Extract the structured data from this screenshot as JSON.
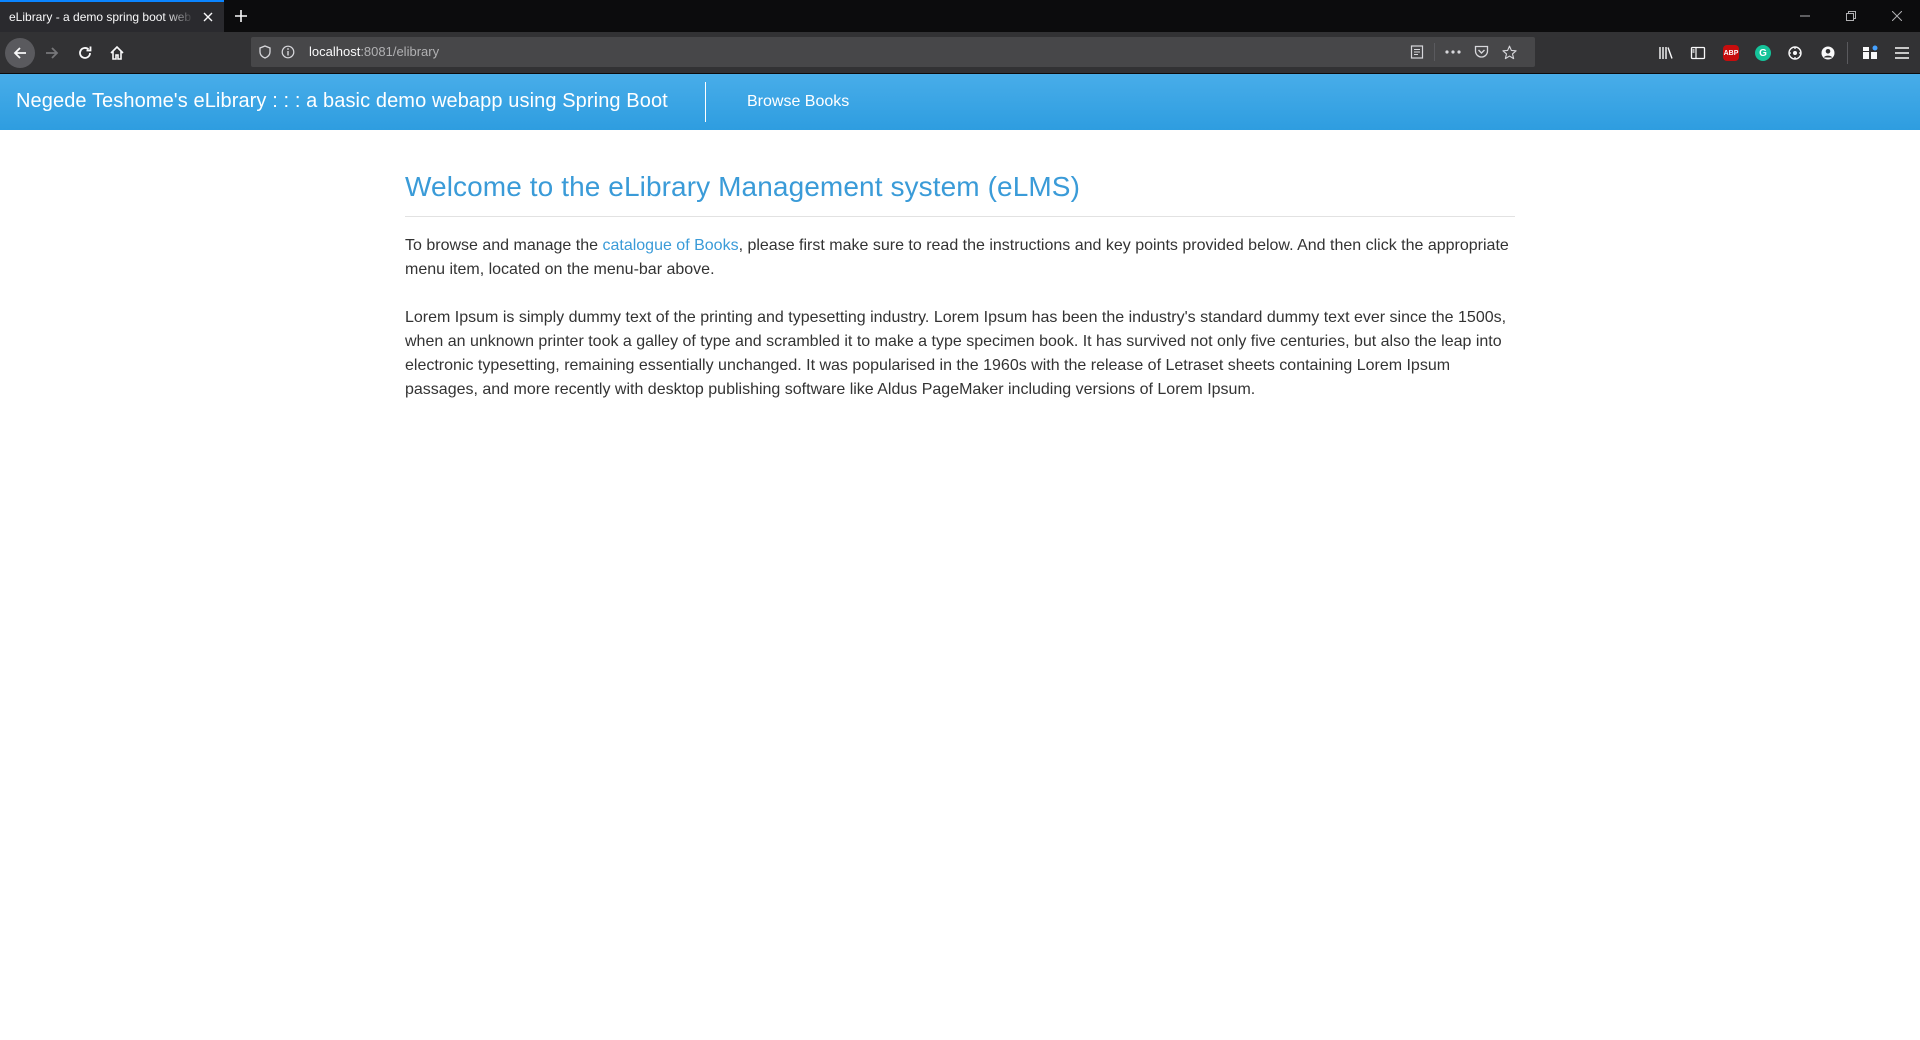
{
  "browser": {
    "tab_title": "eLibrary - a demo spring boot web",
    "url_host": "localhost",
    "url_path": ":8081/elibrary",
    "icons": {
      "tab_close": "close-icon",
      "new_tab": "plus-icon",
      "minimize": "minimize-icon",
      "restore": "restore-icon",
      "close_window": "close-window-icon",
      "back": "arrow-left-icon",
      "forward": "arrow-right-icon",
      "reload": "reload-icon",
      "home": "home-icon",
      "shield": "shield-icon",
      "info": "info-icon",
      "reader": "reader-view-icon",
      "more": "ellipsis-icon",
      "pocket": "pocket-icon",
      "bookmark": "star-icon",
      "library": "library-icon",
      "sidebar": "sidebar-icon",
      "adblock": "adblock-icon",
      "grammarly": "grammarly-icon",
      "extension": "extension-icon",
      "account": "account-icon",
      "extensions": "extensions-icon",
      "menu": "hamburger-menu-icon"
    },
    "adblock_label": "ABP",
    "grammarly_label": "G"
  },
  "app": {
    "brand": "Negede Teshome's eLibrary : : : a basic demo webapp using Spring Boot",
    "nav_browse": "Browse Books",
    "accent_color": "#3a9bd8"
  },
  "content": {
    "title": "Welcome to the eLibrary Management system (eLMS)",
    "intro_before": "To browse and manage the ",
    "intro_link": "catalogue of Books",
    "intro_after": ", please first make sure to read the instructions and key points provided below. And then click the appropriate menu item, located on the menu-bar above.",
    "lorem": "Lorem Ipsum is simply dummy text of the printing and typesetting industry. Lorem Ipsum has been the industry's standard dummy text ever since the 1500s, when an unknown printer took a galley of type and scrambled it to make a type specimen book. It has survived not only five centuries, but also the leap into electronic typesetting, remaining essentially unchanged. It was popularised in the 1960s with the release of Letraset sheets containing Lorem Ipsum passages, and more recently with desktop publishing software like Aldus PageMaker including versions of Lorem Ipsum."
  }
}
